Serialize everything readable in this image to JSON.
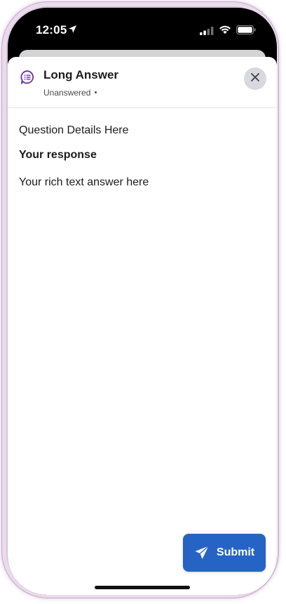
{
  "status_bar": {
    "time": "12:05",
    "location_icon": "location-arrow-icon",
    "signal_icon": "cellular-signal-icon",
    "wifi_icon": "wifi-icon",
    "battery_icon": "battery-icon"
  },
  "header": {
    "icon": "chat-list-icon",
    "title": "Long Answer",
    "status": "Unanswered",
    "close_icon": "close-icon"
  },
  "content": {
    "question_details": "Question Details Here",
    "response_label": "Your response",
    "answer_placeholder": "Your rich text answer here"
  },
  "actions": {
    "submit_label": "Submit",
    "submit_icon": "send-icon"
  },
  "colors": {
    "accent": "#2563c4",
    "icon_purple": "#6b2fa6",
    "close_bg": "#d7d9de"
  }
}
